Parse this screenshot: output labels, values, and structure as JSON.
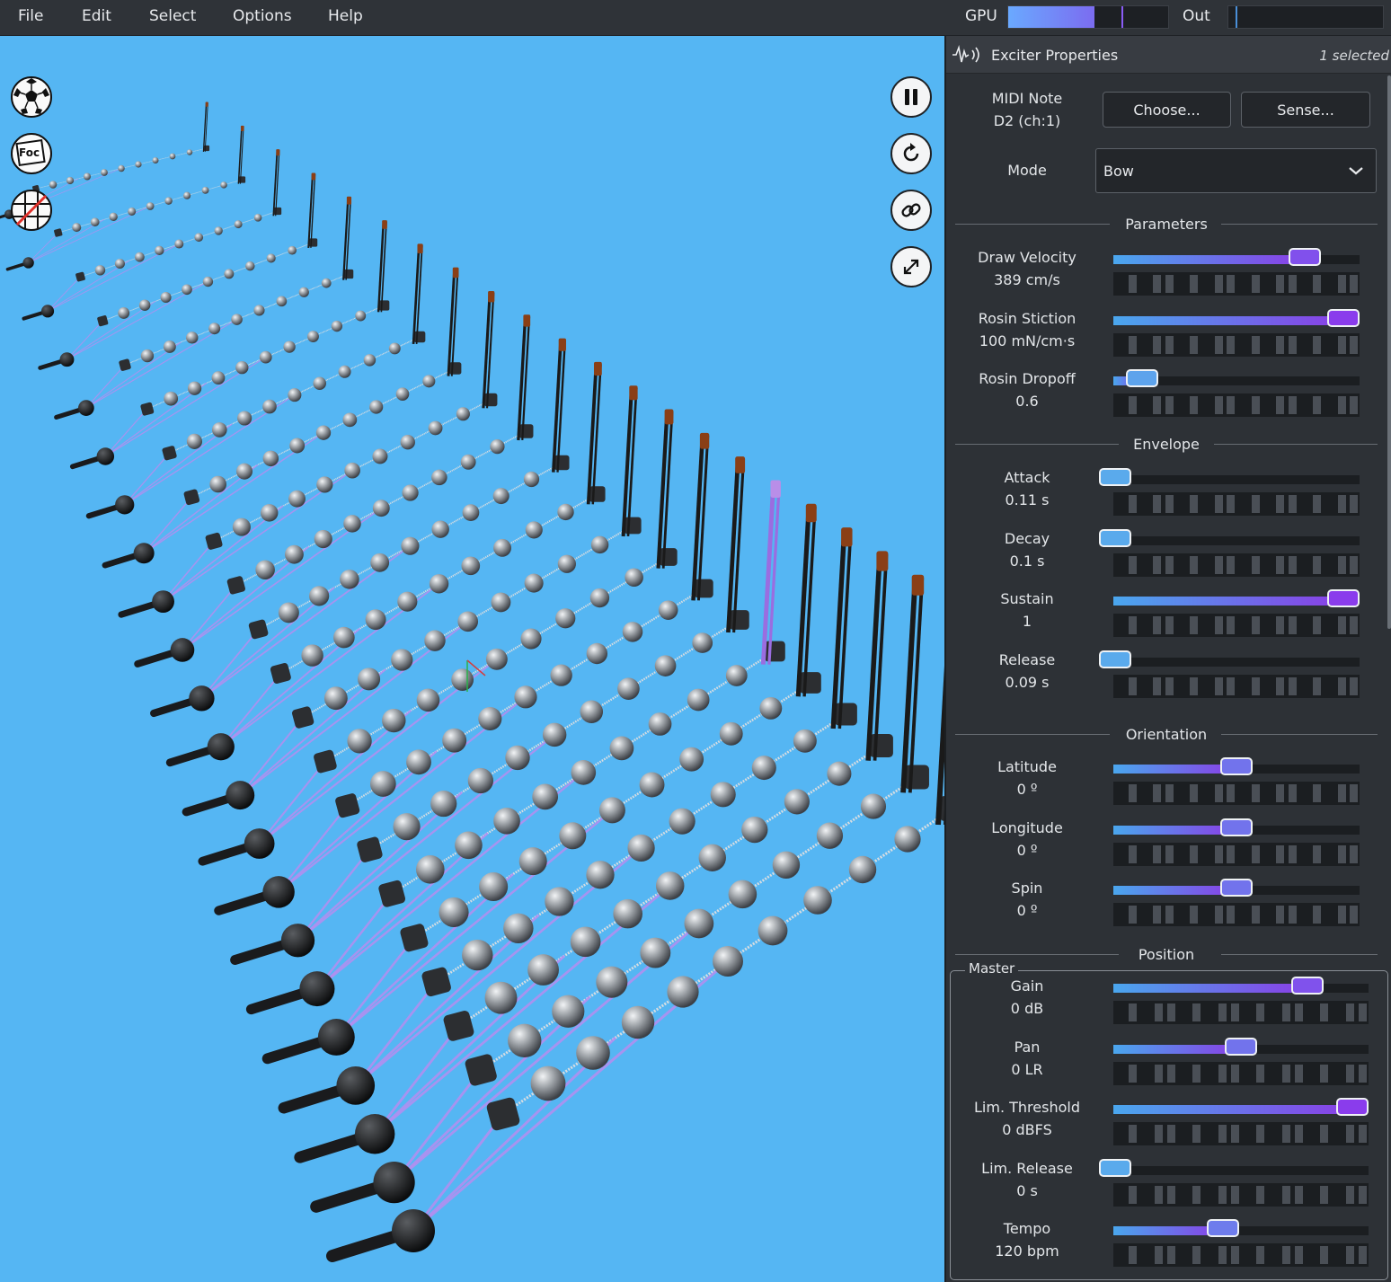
{
  "menu": {
    "file": "File",
    "edit": "Edit",
    "select": "Select",
    "options": "Options",
    "help": "Help"
  },
  "meters": {
    "gpu_label": "GPU",
    "gpu_level": 0.54,
    "out_label": "Out"
  },
  "viewport": {
    "left_tools": [
      {
        "name": "ball-icon"
      },
      {
        "name": "focus-icon",
        "text": "Foc"
      },
      {
        "name": "grid-off-icon"
      }
    ],
    "right_tools": [
      {
        "name": "pause-icon"
      },
      {
        "name": "reset-icon"
      },
      {
        "name": "link-icon"
      },
      {
        "name": "expand-icon"
      }
    ]
  },
  "panel": {
    "title": "Exciter Properties",
    "selected": "1 selected",
    "midi_label": "MIDI Note",
    "midi_value": "D2 (ch:1)",
    "choose_button": "Choose...",
    "sense_button": "Sense...",
    "mode_label": "Mode",
    "mode_value": "Bow",
    "sections": {
      "parameters": "Parameters",
      "envelope": "Envelope",
      "orientation": "Orientation",
      "position": "Position",
      "master": "Master"
    },
    "parameters": [
      {
        "label": "Draw Velocity",
        "value": "389 cm/s",
        "level": 0.82
      },
      {
        "label": "Rosin Stiction",
        "value": "100 mN/cm·s",
        "level": 1.0
      },
      {
        "label": "Rosin Dropoff",
        "value": "0.6",
        "level": 0.06
      }
    ],
    "envelope": [
      {
        "label": "Attack",
        "value": "0.11 s",
        "level": 0.0
      },
      {
        "label": "Decay",
        "value": "0.1 s",
        "level": 0.0
      },
      {
        "label": "Sustain",
        "value": "1",
        "level": 1.0
      },
      {
        "label": "Release",
        "value": "0.09 s",
        "level": 0.0
      }
    ],
    "orientation": [
      {
        "label": "Latitude",
        "value": "0 º",
        "level": 0.5
      },
      {
        "label": "Longitude",
        "value": "0 º",
        "level": 0.5
      },
      {
        "label": "Spin",
        "value": "0 º",
        "level": 0.5
      }
    ],
    "master": [
      {
        "label": "Gain",
        "value": "0 dB",
        "level": 0.8
      },
      {
        "label": "Pan",
        "value": "0 LR",
        "level": 0.5
      },
      {
        "label": "Lim. Threshold",
        "value": "0 dBFS",
        "level": 1.0
      },
      {
        "label": "Lim. Release",
        "value": "0 s",
        "level": 0.0
      },
      {
        "label": "Tempo",
        "value": "120 bpm",
        "level": 0.42
      }
    ]
  }
}
